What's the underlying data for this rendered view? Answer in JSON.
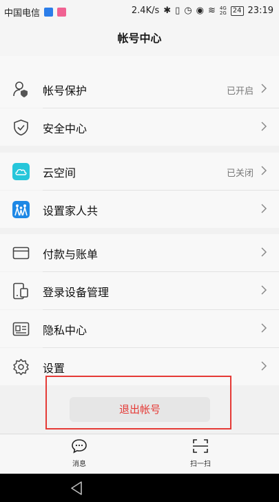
{
  "status_bar": {
    "carrier": "中国电信",
    "speed": "2.4K/s",
    "net_label_top": "4G",
    "net_label_bottom": "2G",
    "battery": "24",
    "time": "23:19"
  },
  "header": {
    "title": "帐号中心"
  },
  "settings": {
    "group1": [
      {
        "label": "帐号保护",
        "value": "已开启",
        "icon": "person-shield-icon"
      },
      {
        "label": "安全中心",
        "value": "",
        "icon": "shield-check-icon"
      }
    ],
    "group2": [
      {
        "label": "云空间",
        "value": "已关闭",
        "icon": "cloud-icon"
      },
      {
        "label": "设置家人共",
        "value": "",
        "icon": "family-icon"
      }
    ],
    "group3": [
      {
        "label": "付款与账单",
        "value": "",
        "icon": "card-icon"
      },
      {
        "label": "登录设备管理",
        "value": "",
        "icon": "devices-icon"
      },
      {
        "label": "隐私中心",
        "value": "",
        "icon": "id-card-icon"
      },
      {
        "label": "设置",
        "value": "",
        "icon": "gear-icon"
      }
    ]
  },
  "logout_button": {
    "label": "退出帐号"
  },
  "tabbar": {
    "messages": {
      "label": "消息",
      "icon": "chat-bubble-icon"
    },
    "scan": {
      "label": "扫一扫",
      "icon": "scan-icon"
    }
  },
  "colors": {
    "accent_red": "#e53935",
    "cloud_teal": "#26c6da",
    "family_blue": "#1e88e5"
  }
}
